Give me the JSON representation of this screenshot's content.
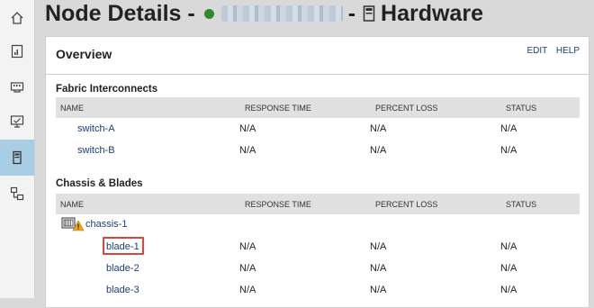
{
  "rail": {
    "items": [
      {
        "icon": "home-icon",
        "active": false
      },
      {
        "icon": "report-icon",
        "active": false
      },
      {
        "icon": "network-card-icon",
        "active": false
      },
      {
        "icon": "monitor-icon",
        "active": false
      },
      {
        "icon": "hardware-icon",
        "active": true
      },
      {
        "icon": "topology-icon",
        "active": false
      }
    ]
  },
  "header": {
    "title_prefix": "Node Details -",
    "separator": "-",
    "title_suffix": "Hardware",
    "status_color": "#2f8a2f"
  },
  "card": {
    "title": "Overview",
    "edit_label": "EDIT",
    "help_label": "HELP"
  },
  "columns": {
    "name": "NAME",
    "response": "RESPONSE TIME",
    "loss": "PERCENT LOSS",
    "status": "STATUS"
  },
  "fabric": {
    "title": "Fabric Interconnects",
    "rows": [
      {
        "name": "switch-A",
        "response": "N/A",
        "loss": "N/A",
        "status": "N/A"
      },
      {
        "name": "switch-B",
        "response": "N/A",
        "loss": "N/A",
        "status": "N/A"
      }
    ]
  },
  "chassis": {
    "title": "Chassis & Blades",
    "group_name": "chassis-1",
    "rows": [
      {
        "name": "blade-1",
        "response": "N/A",
        "loss": "N/A",
        "status": "N/A"
      },
      {
        "name": "blade-2",
        "response": "N/A",
        "loss": "N/A",
        "status": "N/A"
      },
      {
        "name": "blade-3",
        "response": "N/A",
        "loss": "N/A",
        "status": "N/A"
      }
    ]
  }
}
